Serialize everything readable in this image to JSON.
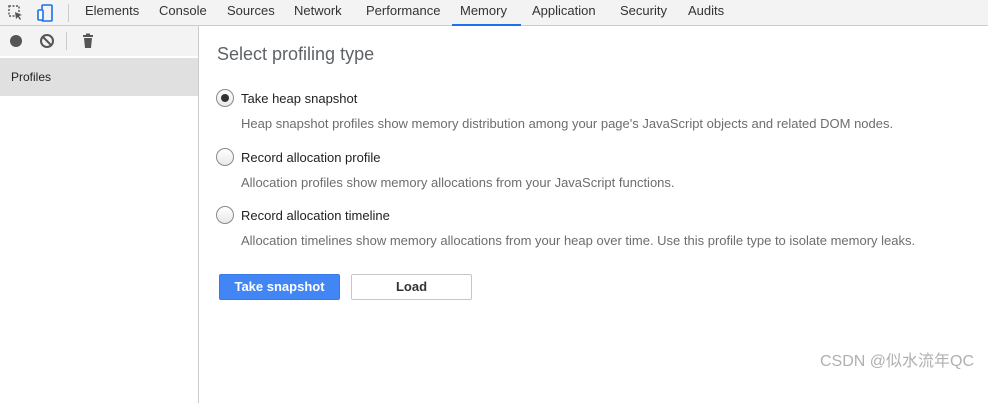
{
  "tabs": [
    {
      "label": "Elements"
    },
    {
      "label": "Console"
    },
    {
      "label": "Sources"
    },
    {
      "label": "Network"
    },
    {
      "label": "Performance"
    },
    {
      "label": "Memory",
      "active": true
    },
    {
      "label": "Application"
    },
    {
      "label": "Security"
    },
    {
      "label": "Audits"
    }
  ],
  "toolbar_icons": [
    "inspect-element-icon",
    "device-toolbar-icon"
  ],
  "sidebar": {
    "tools": [
      "record-icon",
      "clear-icon",
      "garbage-collect-icon"
    ],
    "profiles_label": "Profiles"
  },
  "main": {
    "heading": "Select profiling type",
    "options": [
      {
        "label": "Take heap snapshot",
        "description": "Heap snapshot profiles show memory distribution among your page's JavaScript objects and related DOM nodes.",
        "selected": true
      },
      {
        "label": "Record allocation profile",
        "description": "Allocation profiles show memory allocations from your JavaScript functions.",
        "selected": false
      },
      {
        "label": "Record allocation timeline",
        "description": "Allocation timelines show memory allocations from your heap over time. Use this profile type to isolate memory leaks.",
        "selected": false
      }
    ],
    "primary_button": "Take snapshot",
    "secondary_button": "Load"
  },
  "watermark": "CSDN @似水流年QC",
  "colors": {
    "accent": "#4285f4",
    "active_tab_underline": "#1a73e8"
  }
}
